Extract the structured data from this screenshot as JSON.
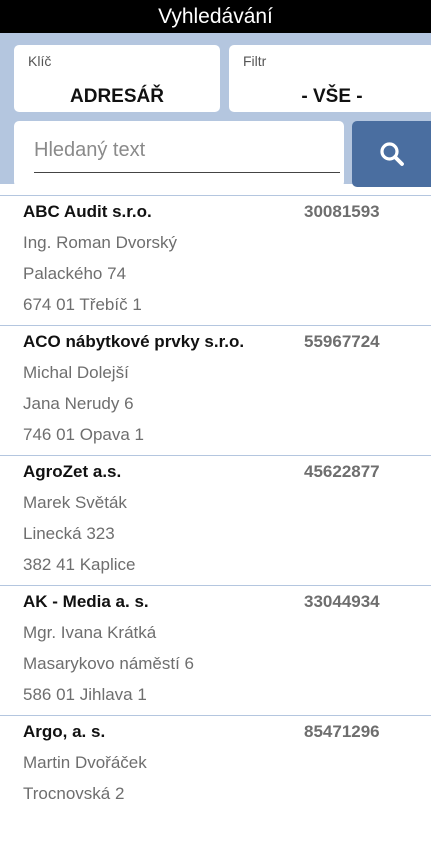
{
  "header": {
    "title": "Vyhledávání"
  },
  "key": {
    "caption": "Klíč",
    "value": "ADRESÁŘ"
  },
  "filter": {
    "caption": "Filtr",
    "value": "- VŠE -"
  },
  "search": {
    "placeholder": "Hledaný text",
    "value": "",
    "button_icon": "search-icon"
  },
  "records": [
    {
      "name": "ABC Audit s.r.o.",
      "ico": "30081593",
      "contact": "Ing. Roman Dvorský",
      "street": "Palackého 74",
      "city": "674 01 Třebíč 1"
    },
    {
      "name": "ACO nábytkové prvky s.r.o.",
      "ico": "55967724",
      "contact": "Michal Dolejší",
      "street": "Jana Nerudy 6",
      "city": "746 01 Opava 1"
    },
    {
      "name": "AgroZet a.s.",
      "ico": "45622877",
      "contact": "Marek Světák",
      "street": "Linecká 323",
      "city": "382 41 Kaplice"
    },
    {
      "name": "AK - Media a. s.",
      "ico": "33044934",
      "contact": "Mgr. Ivana Krátká",
      "street": "Masarykovo náměstí 6",
      "city": "586 01 Jihlava 1"
    },
    {
      "name": "Argo, a. s.",
      "ico": "85471296",
      "contact": "Martin Dvořáček",
      "street": "Trocnovská 2",
      "city": ""
    }
  ],
  "colors": {
    "titlebar": "#000000",
    "panel": "#b4c6df",
    "search_button": "#4a6ea0",
    "secondary_text": "#6e6e6e"
  }
}
